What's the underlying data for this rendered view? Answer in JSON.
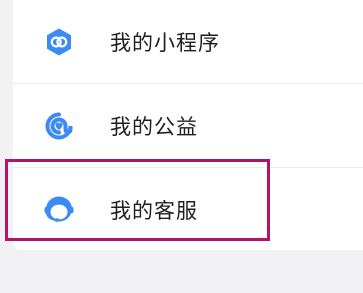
{
  "menu": {
    "items": [
      {
        "label": "我的小程序",
        "icon": "mini-program-icon"
      },
      {
        "label": "我的公益",
        "icon": "charity-icon"
      },
      {
        "label": "我的客服",
        "icon": "customer-service-icon"
      }
    ]
  },
  "colors": {
    "icon_blue": "#3c8af6",
    "highlight": "#b0156a",
    "background": "#f2f2f4",
    "card": "#ffffff"
  }
}
